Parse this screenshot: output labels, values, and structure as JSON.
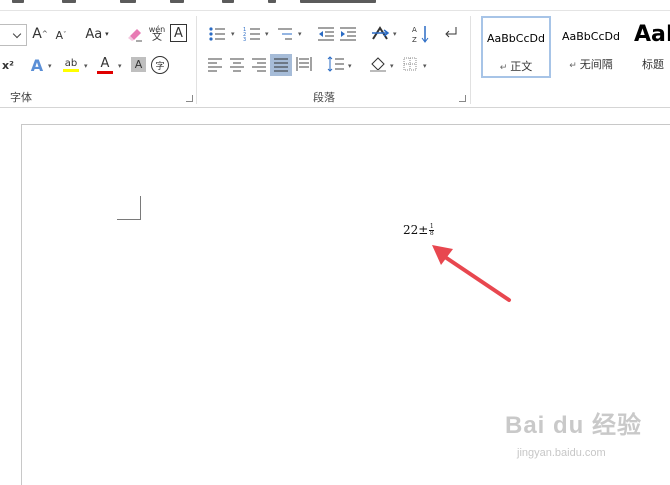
{
  "ribbon": {
    "font_group": {
      "label": "字体",
      "grow_font_glyph": "A",
      "shrink_font_glyph": "A",
      "change_case_label": "Aa",
      "phonetic_top": "wén",
      "phonetic_bottom": "文",
      "char_border_glyph": "A",
      "superscript_label": "x²",
      "text_effects_glyph": "A",
      "highlight_glyph": "ab",
      "font_color_glyph": "A",
      "char_shading_glyph": "A",
      "enclose_char_glyph": "字",
      "highlight_color": "#ffff00",
      "font_color": "#e00000"
    },
    "paragraph_group": {
      "label": "段落"
    },
    "styles": [
      {
        "sample": "AaBbCcDd",
        "name": "正文",
        "selected": true
      },
      {
        "sample": "AaBbCcDd",
        "name": "无间隔",
        "selected": false
      },
      {
        "sample": "AaB",
        "name": "标题",
        "selected": false
      }
    ]
  },
  "document": {
    "equation_base": "22",
    "equation_sign": "±",
    "equation_frac_num": "1",
    "equation_frac_den": "8"
  },
  "watermark": {
    "brand": "Bai du 经验",
    "url": "jingyan.baidu.com"
  },
  "annotation": {
    "arrow_color": "#e8474f"
  }
}
